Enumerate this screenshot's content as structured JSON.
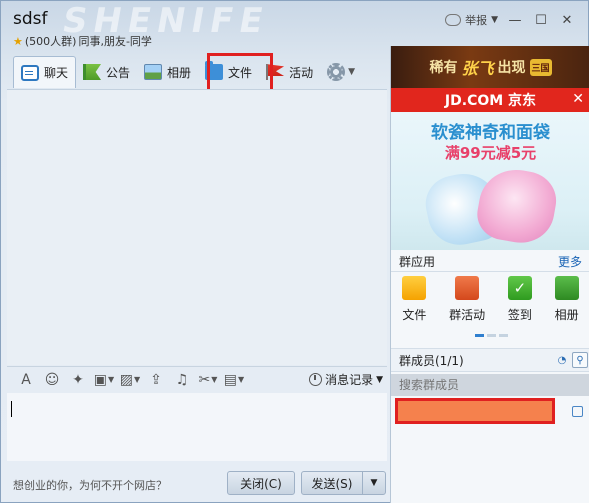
{
  "header": {
    "group_name": "sdsf",
    "group_size": "(500人群)",
    "group_tags": "同事,朋友-同学",
    "report_label": "举报"
  },
  "tabs": [
    {
      "label": "聊天",
      "icon": "chat-icon"
    },
    {
      "label": "公告",
      "icon": "notice-flag-icon"
    },
    {
      "label": "相册",
      "icon": "album-icon"
    },
    {
      "label": "文件",
      "icon": "folder-icon"
    },
    {
      "label": "活动",
      "icon": "activity-flag-icon"
    }
  ],
  "toolbar": {
    "history_label": "消息记录"
  },
  "bottom": {
    "ad_text": "想创业的你，为何不开个网店？",
    "close_label": "关闭(C)",
    "send_label": "发送(S)"
  },
  "sidebar": {
    "banner_text_1": "稀有",
    "banner_text_2": "张飞",
    "banner_text_3": "出现",
    "banner_logo": "三国",
    "jd_label": "JD.COM 京东",
    "ad_line1": "软瓷神奇和面袋",
    "ad_line2": "满99元减5元",
    "apps_title": "群应用",
    "apps_more": "更多",
    "apps": [
      {
        "label": "文件",
        "icon": "file-app-icon"
      },
      {
        "label": "群活动",
        "icon": "group-activity-icon"
      },
      {
        "label": "签到",
        "icon": "checkin-icon"
      },
      {
        "label": "相册",
        "icon": "album-app-icon"
      }
    ],
    "members_title": "群成员(1/1)",
    "members_search_placeholder": "搜索群成员"
  },
  "colors": {
    "highlight": "#e02020",
    "jd_red": "#e1261d",
    "link_blue": "#1a64b5",
    "member_redacted": "#f5814d"
  }
}
